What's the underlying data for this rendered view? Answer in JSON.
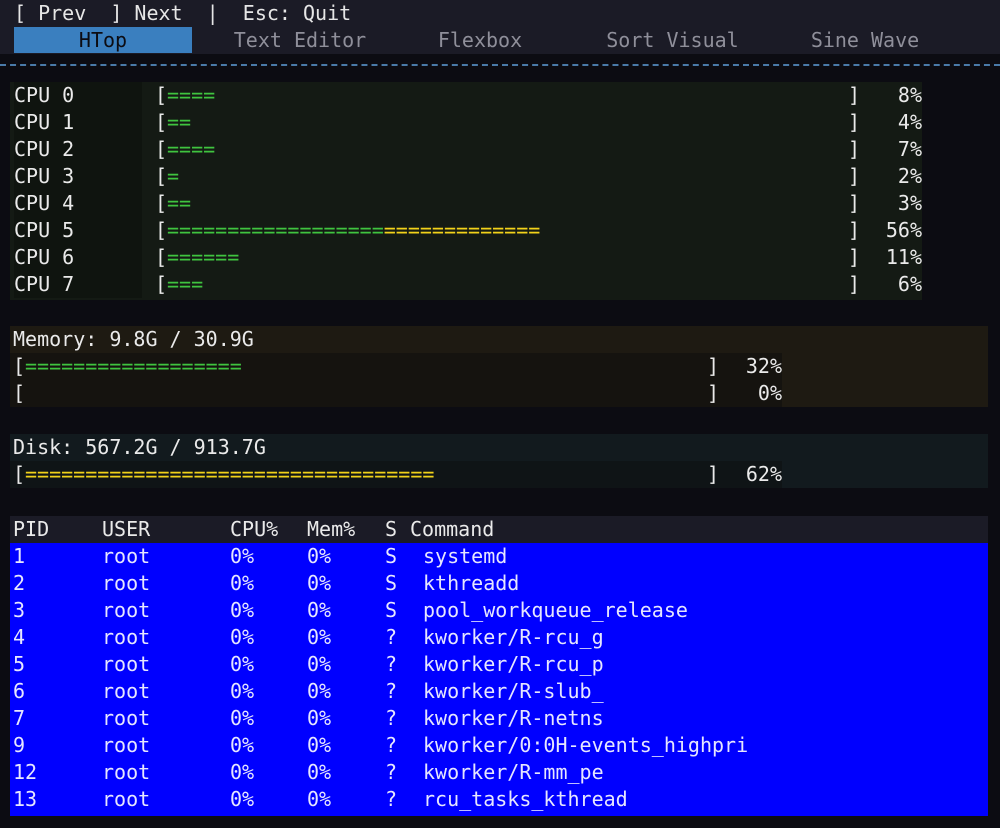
{
  "topbar": {
    "hint": "[ Prev  ] Next  |  Esc: Quit"
  },
  "tabs": [
    {
      "label": "HTop",
      "active": true
    },
    {
      "label": "Text Editor",
      "active": false
    },
    {
      "label": "Flexbox",
      "active": false
    },
    {
      "label": "Sort Visual",
      "active": false
    },
    {
      "label": "Sine Wave",
      "active": false
    }
  ],
  "cpus": [
    {
      "label": "CPU 0",
      "percent_text": "8%",
      "green_segment": "====",
      "yellow_segment": ""
    },
    {
      "label": "CPU 1",
      "percent_text": "4%",
      "green_segment": "==",
      "yellow_segment": ""
    },
    {
      "label": "CPU 2",
      "percent_text": "7%",
      "green_segment": "====",
      "yellow_segment": ""
    },
    {
      "label": "CPU 3",
      "percent_text": "2%",
      "green_segment": "=",
      "yellow_segment": ""
    },
    {
      "label": "CPU 4",
      "percent_text": "3%",
      "green_segment": "==",
      "yellow_segment": ""
    },
    {
      "label": "CPU 5",
      "percent_text": "56%",
      "green_segment": "==================",
      "yellow_segment": "============="
    },
    {
      "label": "CPU 6",
      "percent_text": "11%",
      "green_segment": "======",
      "yellow_segment": ""
    },
    {
      "label": "CPU 7",
      "percent_text": "6%",
      "green_segment": "===",
      "yellow_segment": ""
    }
  ],
  "memory": {
    "title": "Memory: 9.8G / 30.9G",
    "rows": [
      {
        "percent_text": "32%",
        "green_segment": "==================",
        "yellow_segment": ""
      },
      {
        "percent_text": "0%",
        "green_segment": "",
        "yellow_segment": ""
      }
    ]
  },
  "disk": {
    "title": "Disk: 567.2G / 913.7G",
    "rows": [
      {
        "percent_text": "62%",
        "green_segment": "",
        "yellow_segment": "=================================="
      }
    ]
  },
  "brackets": {
    "open": "[",
    "close": "]"
  },
  "process_table": {
    "headers": {
      "pid": "PID",
      "user": "USER",
      "cpu": "CPU%",
      "mem": "Mem%",
      "state": "S",
      "command": "Command"
    },
    "rows": [
      {
        "pid": "1",
        "user": "root",
        "cpu": "0%",
        "mem": "0%",
        "state": "S",
        "command": "systemd"
      },
      {
        "pid": "2",
        "user": "root",
        "cpu": "0%",
        "mem": "0%",
        "state": "S",
        "command": "kthreadd"
      },
      {
        "pid": "3",
        "user": "root",
        "cpu": "0%",
        "mem": "0%",
        "state": "S",
        "command": "pool_workqueue_release"
      },
      {
        "pid": "4",
        "user": "root",
        "cpu": "0%",
        "mem": "0%",
        "state": "?",
        "command": "kworker/R-rcu_g"
      },
      {
        "pid": "5",
        "user": "root",
        "cpu": "0%",
        "mem": "0%",
        "state": "?",
        "command": "kworker/R-rcu_p"
      },
      {
        "pid": "6",
        "user": "root",
        "cpu": "0%",
        "mem": "0%",
        "state": "?",
        "command": "kworker/R-slub_"
      },
      {
        "pid": "7",
        "user": "root",
        "cpu": "0%",
        "mem": "0%",
        "state": "?",
        "command": "kworker/R-netns"
      },
      {
        "pid": "9",
        "user": "root",
        "cpu": "0%",
        "mem": "0%",
        "state": "?",
        "command": "kworker/0:0H-events_highpri"
      },
      {
        "pid": "12",
        "user": "root",
        "cpu": "0%",
        "mem": "0%",
        "state": "?",
        "command": "kworker/R-mm_pe"
      },
      {
        "pid": "13",
        "user": "root",
        "cpu": "0%",
        "mem": "0%",
        "state": "?",
        "command": "rcu_tasks_kthread"
      }
    ]
  },
  "colors": {
    "bar_low": "#3fc43f",
    "bar_high": "#f2d21a",
    "active_tab": "#3a7fbf",
    "selection": "#0000ff",
    "background": "#0c0c12"
  }
}
